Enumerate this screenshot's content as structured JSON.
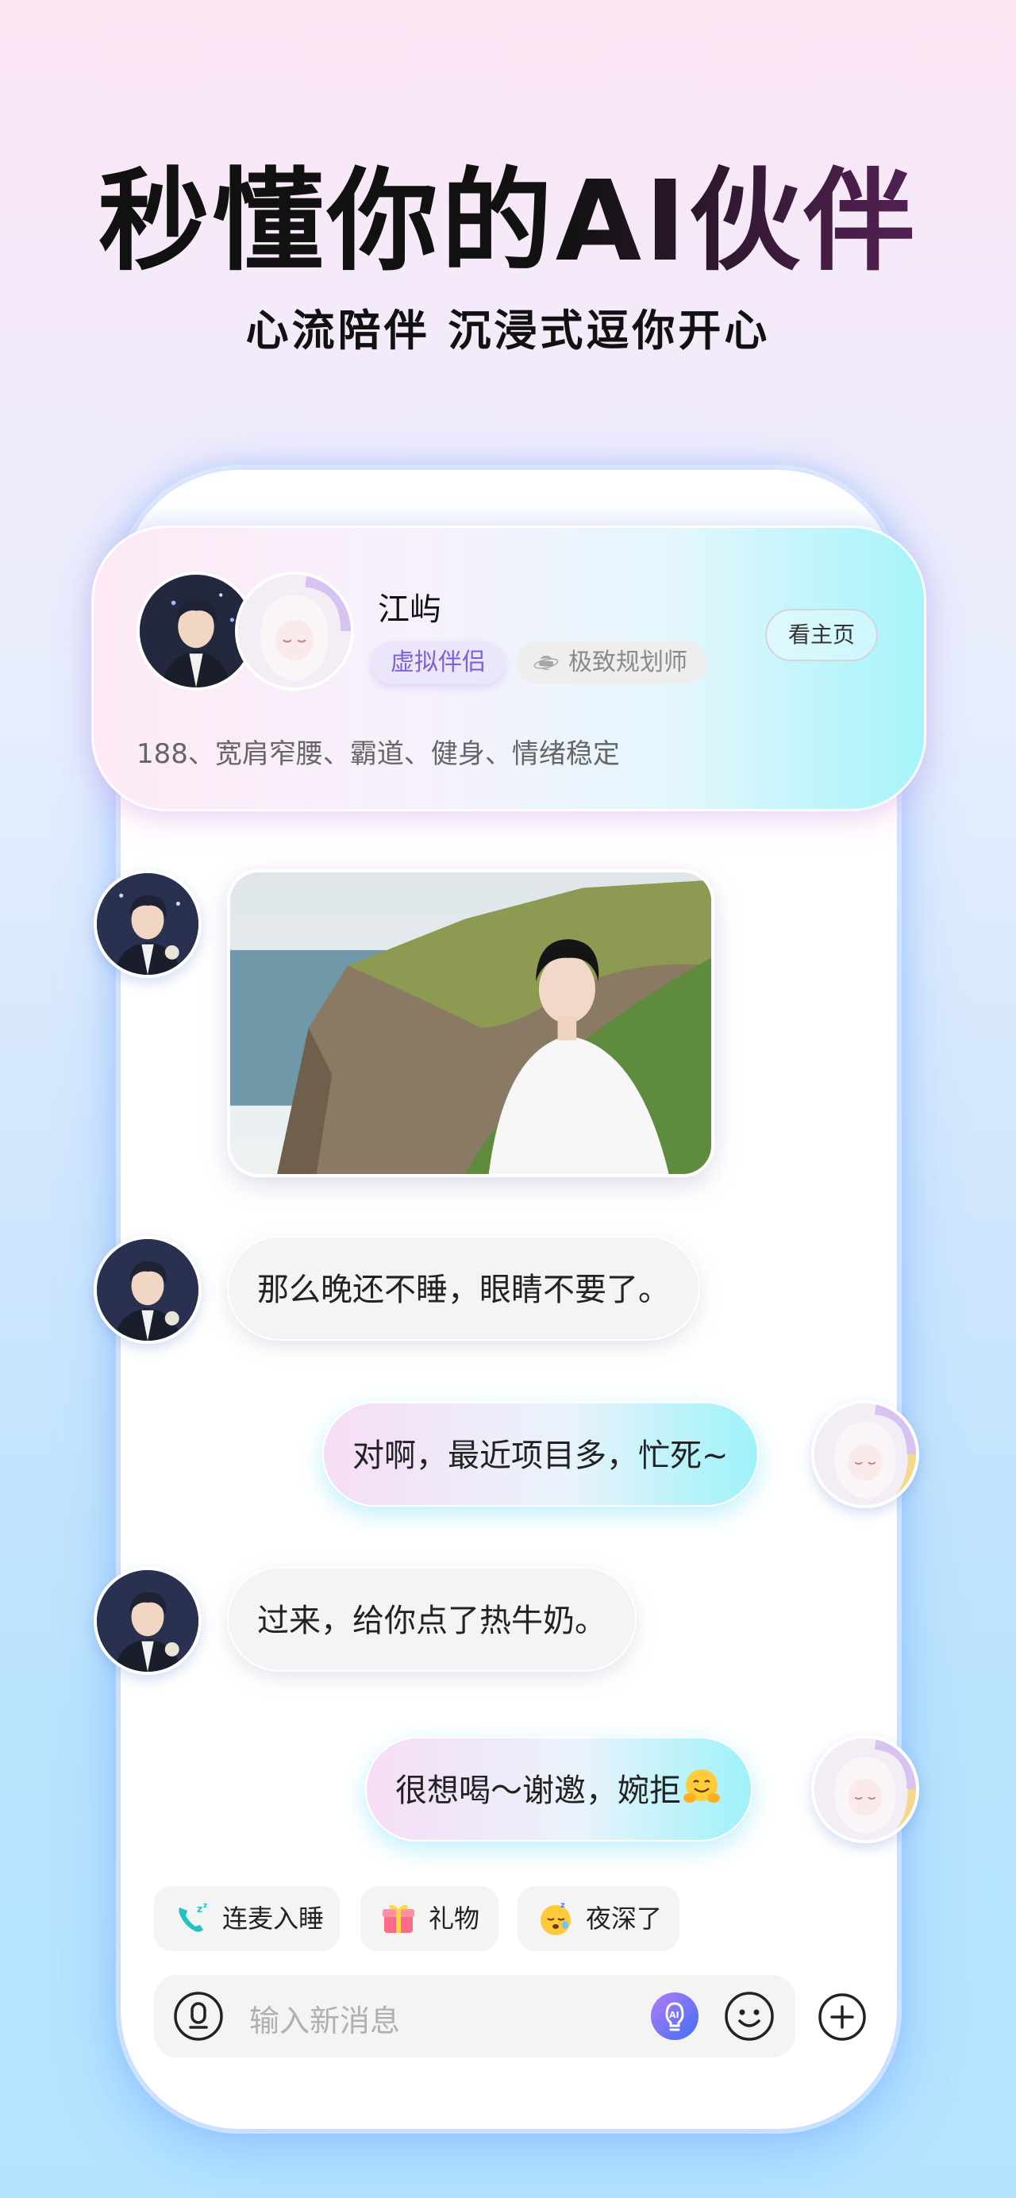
{
  "hero": {
    "title": "秒懂你的AI伙伴",
    "subtitle": "心流陪伴 沉浸式逗你开心"
  },
  "profile": {
    "name": "江屿",
    "tags": [
      "虚拟伴侣",
      "极致规划师"
    ],
    "home_button": "看主页",
    "bio": "188、宽肩窄腰、霸道、健身、情绪稳定"
  },
  "messages": [
    {
      "from": "character",
      "type": "image"
    },
    {
      "from": "character",
      "text": "那么晚还不睡，眼睛不要了。"
    },
    {
      "from": "user",
      "text": "对啊，最近项目多，忙死~"
    },
    {
      "from": "character",
      "text": "过来，给你点了热牛奶。"
    },
    {
      "from": "user",
      "text": "很想喝～谢邀，婉拒",
      "emoji": "hugging-face"
    }
  ],
  "quick_actions": [
    {
      "label": "连麦入睡",
      "icon": "phone-sleep-icon"
    },
    {
      "label": "礼物",
      "icon": "gift-icon"
    },
    {
      "label": "夜深了",
      "icon": "sleepy-face-icon"
    }
  ],
  "composer": {
    "placeholder": "输入新消息"
  },
  "colors": {
    "accent_purple": "#7b62d6",
    "ai_button_blue": "#4a6cf7"
  }
}
